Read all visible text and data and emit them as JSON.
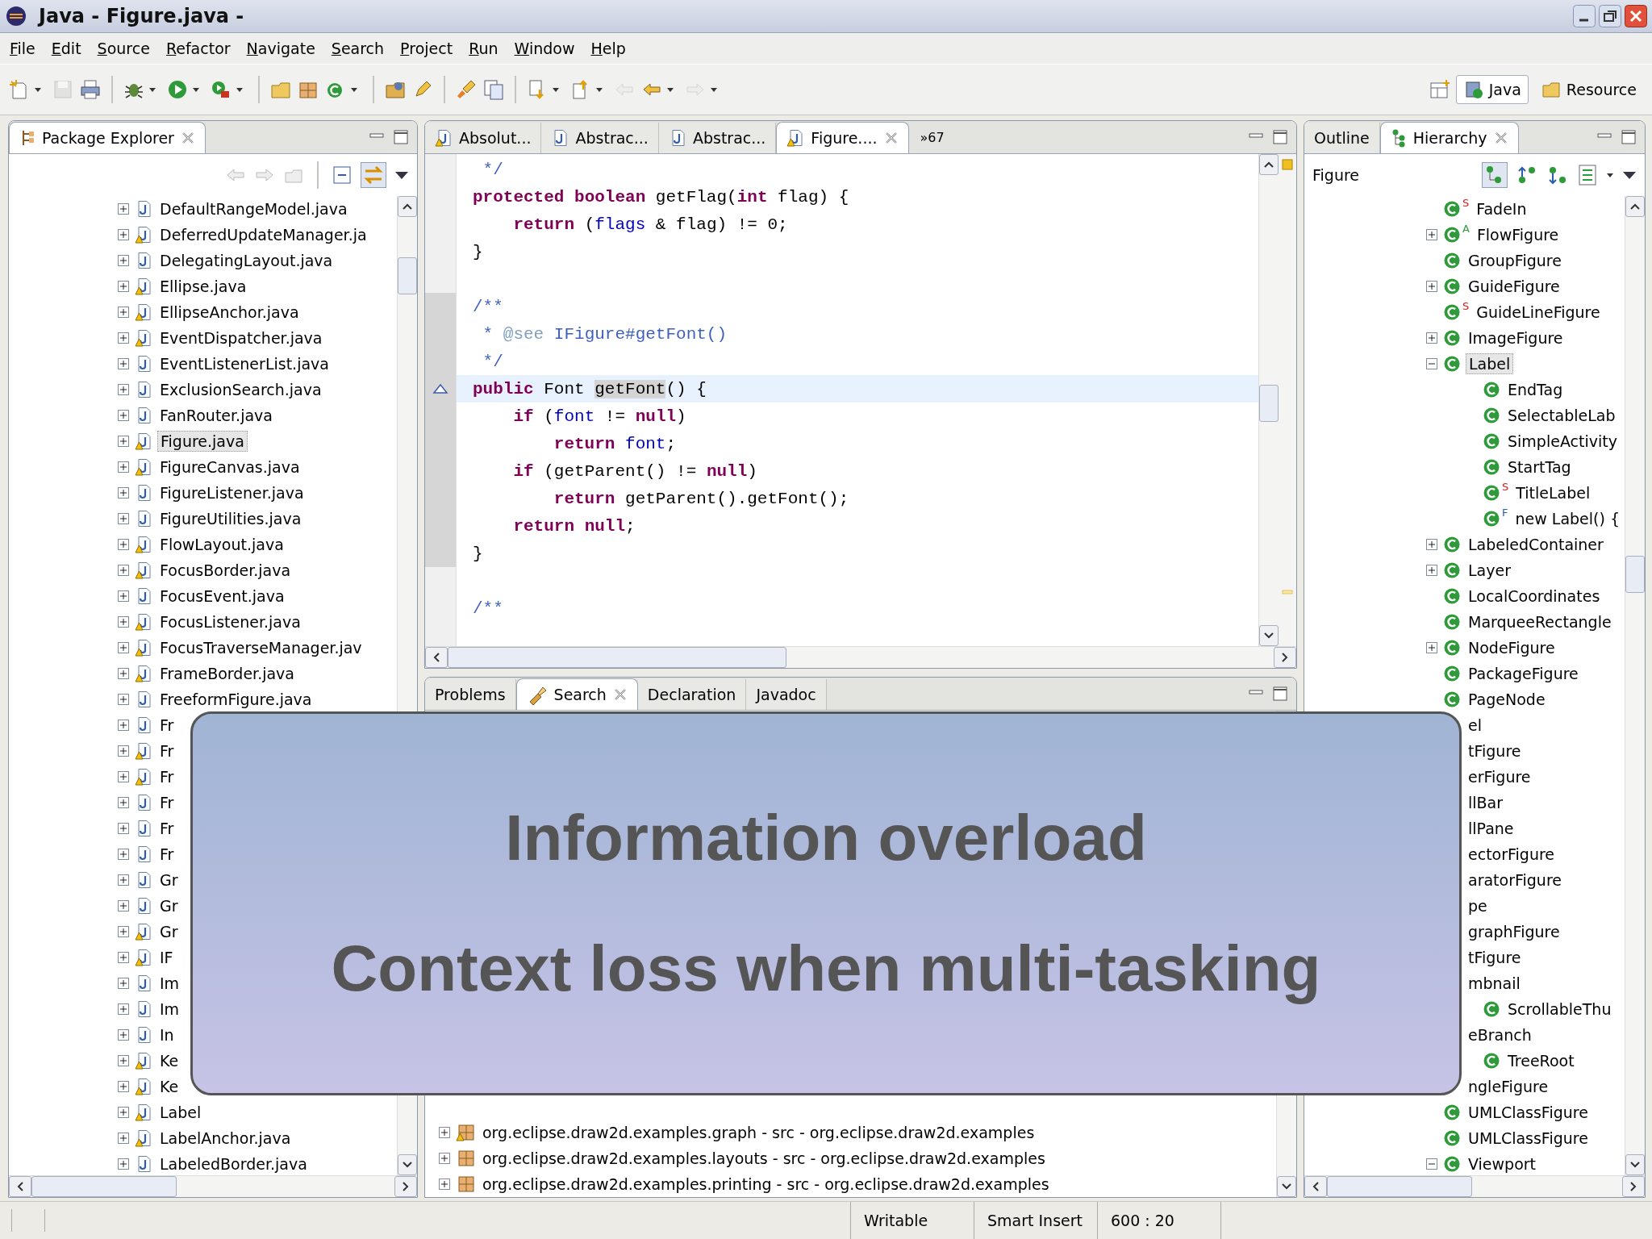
{
  "window": {
    "title": "Java - Figure.java -"
  },
  "menu": [
    "File",
    "Edit",
    "Source",
    "Refactor",
    "Navigate",
    "Search",
    "Project",
    "Run",
    "Window",
    "Help"
  ],
  "perspectives": [
    {
      "label": "Java",
      "selected": true
    },
    {
      "label": "Resource",
      "selected": false
    }
  ],
  "package_explorer": {
    "tabs": [
      {
        "label": "Package Explorer",
        "selected": true
      }
    ],
    "items": [
      {
        "label": "DefaultRangeModel.java",
        "warning": false,
        "selected": false
      },
      {
        "label": "DeferredUpdateManager.ja",
        "warning": true,
        "selected": false
      },
      {
        "label": "DelegatingLayout.java",
        "warning": false,
        "selected": false
      },
      {
        "label": "Ellipse.java",
        "warning": true,
        "selected": false
      },
      {
        "label": "EllipseAnchor.java",
        "warning": true,
        "selected": false
      },
      {
        "label": "EventDispatcher.java",
        "warning": true,
        "selected": false
      },
      {
        "label": "EventListenerList.java",
        "warning": false,
        "selected": false
      },
      {
        "label": "ExclusionSearch.java",
        "warning": false,
        "selected": false
      },
      {
        "label": "FanRouter.java",
        "warning": false,
        "selected": false
      },
      {
        "label": "Figure.java",
        "warning": true,
        "selected": true
      },
      {
        "label": "FigureCanvas.java",
        "warning": true,
        "selected": false
      },
      {
        "label": "FigureListener.java",
        "warning": false,
        "selected": false
      },
      {
        "label": "FigureUtilities.java",
        "warning": false,
        "selected": false
      },
      {
        "label": "FlowLayout.java",
        "warning": true,
        "selected": false
      },
      {
        "label": "FocusBorder.java",
        "warning": true,
        "selected": false
      },
      {
        "label": "FocusEvent.java",
        "warning": false,
        "selected": false
      },
      {
        "label": "FocusListener.java",
        "warning": true,
        "selected": false
      },
      {
        "label": "FocusTraverseManager.jav",
        "warning": true,
        "selected": false
      },
      {
        "label": "FrameBorder.java",
        "warning": true,
        "selected": false
      },
      {
        "label": "FreeformFigure.java",
        "warning": false,
        "selected": false
      },
      {
        "label": "Fr",
        "warning": false,
        "selected": false
      },
      {
        "label": "Fr",
        "warning": true,
        "selected": false
      },
      {
        "label": "Fr",
        "warning": true,
        "selected": false
      },
      {
        "label": "Fr",
        "warning": false,
        "selected": false
      },
      {
        "label": "Fr",
        "warning": false,
        "selected": false
      },
      {
        "label": "Fr",
        "warning": false,
        "selected": false
      },
      {
        "label": "Gr",
        "warning": false,
        "selected": false
      },
      {
        "label": "Gr",
        "warning": false,
        "selected": false
      },
      {
        "label": "Gr",
        "warning": true,
        "selected": false
      },
      {
        "label": "IF",
        "warning": true,
        "selected": false
      },
      {
        "label": "Im",
        "warning": false,
        "selected": false
      },
      {
        "label": "Im",
        "warning": false,
        "selected": false
      },
      {
        "label": "In",
        "warning": false,
        "selected": false
      },
      {
        "label": "Ke",
        "warning": true,
        "selected": false
      },
      {
        "label": "Ke",
        "warning": true,
        "selected": false
      },
      {
        "label": "Label",
        "warning": true,
        "selected": false
      },
      {
        "label": "LabelAnchor.java",
        "warning": true,
        "selected": false
      },
      {
        "label": "LabeledBorder.java",
        "warning": false,
        "selected": false
      }
    ]
  },
  "editor": {
    "tabs": [
      {
        "label": "Absolut...",
        "warning": true,
        "selected": false
      },
      {
        "label": "Abstrac...",
        "warning": false,
        "selected": false
      },
      {
        "label": "Abstrac...",
        "warning": false,
        "selected": false
      },
      {
        "label": "Figure....",
        "warning": true,
        "selected": true
      }
    ],
    "overflow": "»67",
    "lines": [
      {
        "current": false,
        "tokens": [
          {
            "kind": "javadoc",
            "text": " */"
          }
        ]
      },
      {
        "current": false,
        "tokens": [
          {
            "kind": "keyword",
            "text": "protected"
          },
          {
            "kind": "keyword",
            "text": " boolean"
          },
          {
            "kind": "plain",
            "text": " getFlag("
          },
          {
            "kind": "keyword",
            "text": "int"
          },
          {
            "kind": "plain",
            "text": " flag) {"
          }
        ]
      },
      {
        "current": false,
        "tokens": [
          {
            "kind": "keyword",
            "text": "    return"
          },
          {
            "kind": "plain",
            "text": " ("
          },
          {
            "kind": "field",
            "text": "flags"
          },
          {
            "kind": "plain",
            "text": " & flag) != 0;"
          }
        ]
      },
      {
        "current": false,
        "tokens": [
          {
            "kind": "plain",
            "text": "}"
          }
        ]
      },
      {
        "current": false
      },
      {
        "current": false,
        "tokens": [
          {
            "kind": "javadoc",
            "text": "/**"
          }
        ]
      },
      {
        "current": false,
        "tokens": [
          {
            "kind": "javadoc",
            "text": " * "
          },
          {
            "kind": "javadoc-tag",
            "text": "@see"
          },
          {
            "kind": "javadoc",
            "text": " IFigure#getFont()"
          }
        ]
      },
      {
        "current": false,
        "tokens": [
          {
            "kind": "javadoc",
            "text": " */"
          }
        ]
      },
      {
        "current": true,
        "tokens": [
          {
            "kind": "keyword",
            "text": "public"
          },
          {
            "kind": "plain",
            "text": " Font "
          },
          {
            "kind": "occurrence",
            "text": "getFont"
          },
          {
            "kind": "plain",
            "text": "() {"
          }
        ]
      },
      {
        "current": false,
        "tokens": [
          {
            "kind": "keyword",
            "text": "    if"
          },
          {
            "kind": "plain",
            "text": " ("
          },
          {
            "kind": "field",
            "text": "font"
          },
          {
            "kind": "plain",
            "text": " != "
          },
          {
            "kind": "keyword",
            "text": "null"
          },
          {
            "kind": "plain",
            "text": ")"
          }
        ]
      },
      {
        "current": false,
        "tokens": [
          {
            "kind": "keyword",
            "text": "        return"
          },
          {
            "kind": "field",
            "text": " font"
          },
          {
            "kind": "plain",
            "text": ";"
          }
        ]
      },
      {
        "current": false,
        "tokens": [
          {
            "kind": "keyword",
            "text": "    if"
          },
          {
            "kind": "plain",
            "text": " (getParent() != "
          },
          {
            "kind": "keyword",
            "text": "null"
          },
          {
            "kind": "plain",
            "text": ")"
          }
        ]
      },
      {
        "current": false,
        "tokens": [
          {
            "kind": "keyword",
            "text": "        return"
          },
          {
            "kind": "plain",
            "text": " getParent().getFont();"
          }
        ]
      },
      {
        "current": false,
        "tokens": [
          {
            "kind": "keyword",
            "text": "    return"
          },
          {
            "kind": "keyword",
            "text": " null"
          },
          {
            "kind": "plain",
            "text": ";"
          }
        ]
      },
      {
        "current": false,
        "tokens": [
          {
            "kind": "plain",
            "text": "}"
          }
        ]
      },
      {
        "current": false
      },
      {
        "current": false,
        "tokens": [
          {
            "kind": "javadoc",
            "text": "/**"
          }
        ]
      }
    ]
  },
  "bottom_panel": {
    "tabs": [
      {
        "label": "Problems",
        "selected": false
      },
      {
        "label": "Search",
        "selected": true
      },
      {
        "label": "Declaration",
        "selected": false
      },
      {
        "label": "Javadoc",
        "selected": false
      }
    ],
    "results": [
      {
        "label": "org.eclipse.draw2d.examples.graph - src - org.eclipse.draw2d.examples",
        "warning": true
      },
      {
        "label": "org.eclipse.draw2d.examples.layouts - src - org.eclipse.draw2d.examples",
        "warning": false
      },
      {
        "label": "org.eclipse.draw2d.examples.printing - src - org.eclipse.draw2d.examples",
        "warning": false
      }
    ]
  },
  "hierarchy": {
    "tabs": [
      {
        "label": "Outline",
        "selected": false
      },
      {
        "label": "Hierarchy",
        "selected": true
      }
    ],
    "focus": "Figure",
    "items": [
      {
        "kind": "class",
        "label": "FadeIn",
        "badge": "S",
        "selected": false
      },
      {
        "kind": "class",
        "label": "FlowFigure",
        "expanded": false,
        "badge": "A",
        "selected": false
      },
      {
        "kind": "class",
        "label": "GroupFigure",
        "selected": false
      },
      {
        "kind": "class",
        "label": "GuideFigure",
        "expanded": false,
        "selected": false
      },
      {
        "kind": "class",
        "label": "GuideLineFigure",
        "badge": "S",
        "selected": false
      },
      {
        "kind": "class",
        "label": "ImageFigure",
        "expanded": false,
        "selected": false
      },
      {
        "kind": "class",
        "label": "Label",
        "expanded": true,
        "selected": true,
        "children": [
          {
            "kind": "class",
            "label": "EndTag",
            "selected": false
          },
          {
            "kind": "class",
            "label": "SelectableLab",
            "selected": false
          },
          {
            "kind": "class",
            "label": "SimpleActivity",
            "selected": false
          },
          {
            "kind": "class",
            "label": "StartTag",
            "selected": false
          },
          {
            "kind": "class",
            "label": "TitleLabel",
            "badge": "S",
            "selected": false
          },
          {
            "kind": "class",
            "label": "new Label() {",
            "badge": "F",
            "selected": false
          }
        ]
      },
      {
        "kind": "class",
        "label": "LabeledContainer",
        "expanded": false,
        "selected": false
      },
      {
        "kind": "class",
        "label": "Layer",
        "expanded": false,
        "selected": false
      },
      {
        "kind": "class",
        "label": "LocalCoordinates",
        "selected": false
      },
      {
        "kind": "class",
        "label": "MarqueeRectangle",
        "selected": false
      },
      {
        "kind": "class",
        "label": "NodeFigure",
        "expanded": false,
        "selected": false
      },
      {
        "kind": "class",
        "label": "PackageFigure",
        "selected": false
      },
      {
        "kind": "class",
        "label": "PageNode",
        "selected": false
      },
      {
        "kind": "clipped",
        "label": "el",
        "selected": false
      },
      {
        "kind": "clipped",
        "label": "tFigure",
        "selected": false
      },
      {
        "kind": "clipped",
        "label": "erFigure",
        "selected": false
      },
      {
        "kind": "clipped",
        "label": "llBar",
        "selected": false
      },
      {
        "kind": "clipped",
        "label": "llPane",
        "selected": false
      },
      {
        "kind": "clipped",
        "label": "ectorFigure",
        "selected": false
      },
      {
        "kind": "clipped",
        "label": "aratorFigure",
        "selected": false
      },
      {
        "kind": "clipped",
        "label": "pe",
        "selected": false
      },
      {
        "kind": "clipped",
        "label": "graphFigure",
        "selected": false
      },
      {
        "kind": "clipped",
        "label": "tFigure",
        "selected": false
      },
      {
        "kind": "clipped",
        "label": "mbnail",
        "selected": false,
        "children": [
          {
            "kind": "class",
            "label": "ScrollableThu",
            "selected": false
          }
        ]
      },
      {
        "kind": "clipped",
        "label": "eBranch",
        "selected": false,
        "children": [
          {
            "kind": "class",
            "label": "TreeRoot",
            "selected": false
          }
        ]
      },
      {
        "kind": "clipped",
        "label": "ngleFigure",
        "selected": false
      },
      {
        "kind": "class",
        "label": "UMLClassFigure",
        "selected": false
      },
      {
        "kind": "class",
        "label": "UMLClassFigure",
        "selected": false
      },
      {
        "kind": "class",
        "label": "Viewport",
        "expanded": true,
        "selected": false
      }
    ]
  },
  "overlay": {
    "lines": [
      "Information overload",
      "Context loss when multi-tasking"
    ]
  },
  "status_bar": [
    "Writable",
    "Smart Insert",
    "600 : 20"
  ]
}
